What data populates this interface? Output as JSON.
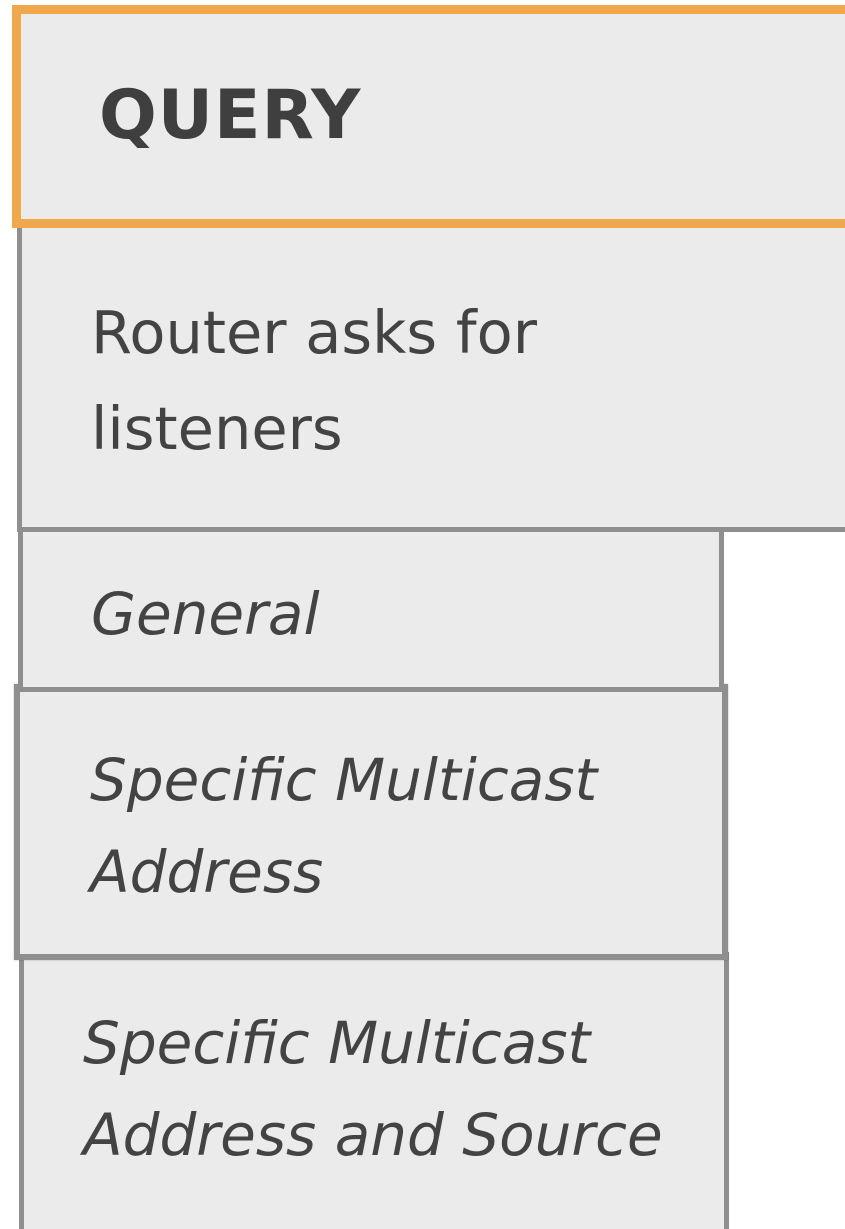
{
  "header": {
    "title": "QUERY"
  },
  "description": {
    "text": "Router asks for listeners"
  },
  "query_types": {
    "general": "General",
    "specific_line1": "Specific Multicast",
    "specific_line2": "Address",
    "source_line1": "Specific Multicast",
    "source_line2": "Address and Source"
  },
  "colors": {
    "header_border": "#efa84b",
    "box_border": "#8f8f8f",
    "box_fill": "#ebebeb",
    "text": "#434343"
  }
}
